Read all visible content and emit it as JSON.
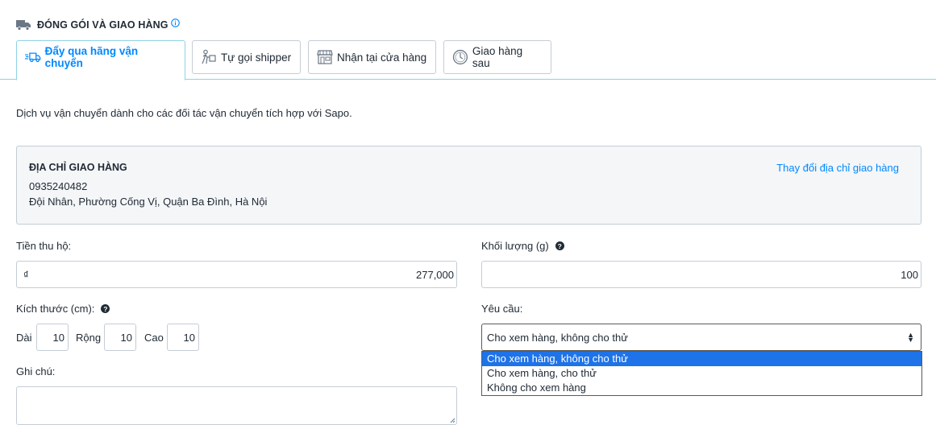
{
  "section": {
    "title": "ĐÓNG GÓI VÀ GIAO HÀNG",
    "icon": "truck-icon",
    "info_icon": "info-icon"
  },
  "tabs": [
    {
      "label": "Đẩy qua hãng vận chuyển",
      "icon": "fast-delivery-icon",
      "active": true
    },
    {
      "label": "Tự gọi shipper",
      "icon": "shipper-icon",
      "active": false
    },
    {
      "label": "Nhận tại cửa hàng",
      "icon": "store-icon",
      "active": false
    },
    {
      "label": "Giao hàng sau",
      "icon": "clock-icon",
      "active": false
    }
  ],
  "description": "Dịch vụ vận chuyển dành cho các đối tác vận chuyển tích hợp với Sapo.",
  "address": {
    "title": "ĐỊA CHỈ GIAO HÀNG",
    "phone": "0935240482",
    "line": "Đội Nhân, Phường Cống Vị, Quận Ba Đình, Hà Nội",
    "change_link": "Thay đổi địa chỉ giao hàng"
  },
  "cod": {
    "label": "Tiền thu hộ:",
    "currency": "₫",
    "value": "277,000"
  },
  "weight": {
    "label": "Khối lượng (g)",
    "value": "100"
  },
  "dimensions": {
    "label": "Kích thước (cm):",
    "length_label": "Dài",
    "length": "10",
    "width_label": "Rộng",
    "width": "10",
    "height_label": "Cao",
    "height": "10"
  },
  "request": {
    "label": "Yêu cầu:",
    "selected": "Cho xem hàng, không cho thử",
    "options": [
      "Cho xem hàng, không cho thử",
      "Cho xem hàng, cho thử",
      "Không cho xem hàng"
    ]
  },
  "note": {
    "label": "Ghi chú:",
    "value": ""
  },
  "colors": {
    "accent": "#0088ff",
    "option_highlight": "#1e73e8",
    "tab_border_active": "#8fd3e6"
  }
}
